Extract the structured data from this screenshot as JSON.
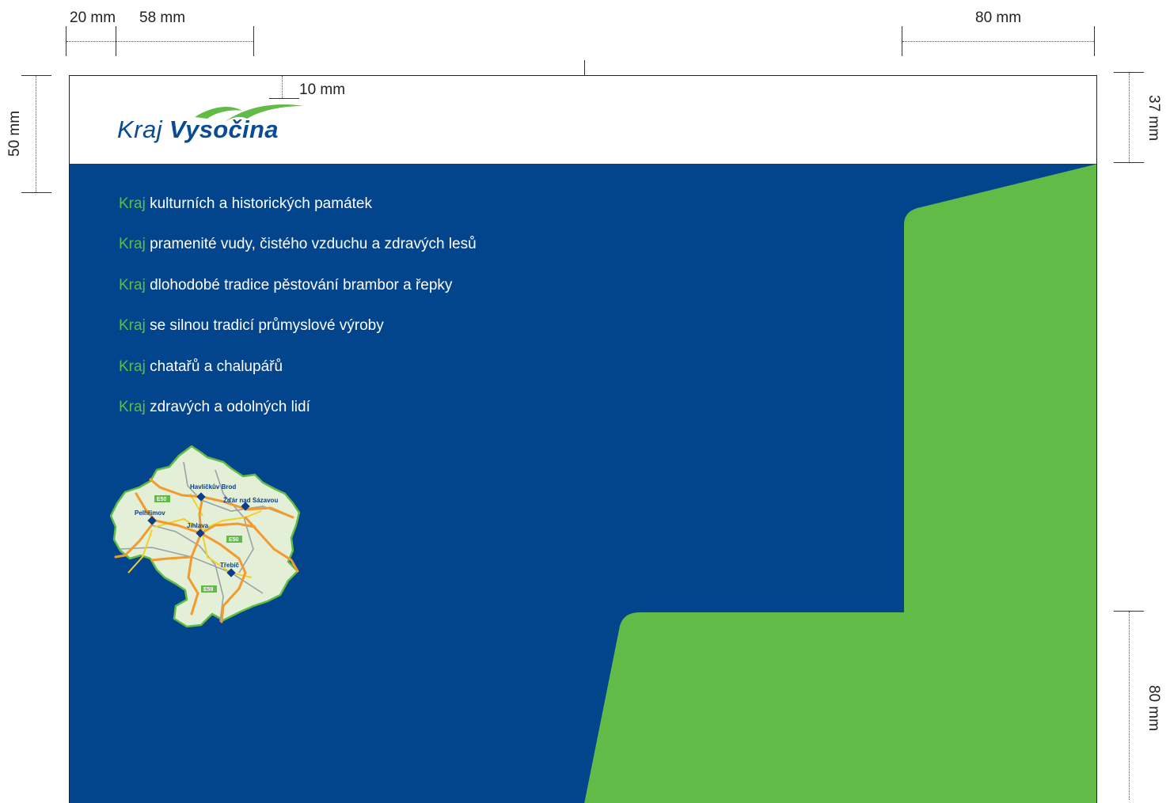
{
  "dimensions": {
    "top_left_margin": "20 mm",
    "top_logo_width": "58 mm",
    "top_right_flap": "80 mm",
    "logo_offset": "10 mm",
    "left_header": "50 mm",
    "right_header": "37 mm",
    "right_flap_height": "80 mm"
  },
  "logo": {
    "word1": "Kraj",
    "word2": "Vysočina"
  },
  "taglines": [
    {
      "keyword": "Kraj",
      "text": "kulturních a historických památek"
    },
    {
      "keyword": "Kraj",
      "text": "pramenité vudy, čistého vzduchu a zdravých lesů"
    },
    {
      "keyword": "Kraj",
      "text": "dlohodobé tradice pěstování brambor a řepky"
    },
    {
      "keyword": "Kraj",
      "text": "se silnou tradicí průmyslové výroby"
    },
    {
      "keyword": "Kraj",
      "text": "chatařů a chalupářů"
    },
    {
      "keyword": "Kraj",
      "text": "zdravých a odolných lidí"
    }
  ],
  "map": {
    "cities": [
      "Havlíčkův Brod",
      "Žďár nad Sázavou",
      "Pelhřimov",
      "Jihlava",
      "Třebíč"
    ],
    "roads": [
      "E50",
      "E50",
      "E59"
    ]
  },
  "colors": {
    "blue": "#02458c",
    "green": "#62bb46",
    "logo_blue": "#0a4b95",
    "map_fill": "#e3efd6"
  }
}
